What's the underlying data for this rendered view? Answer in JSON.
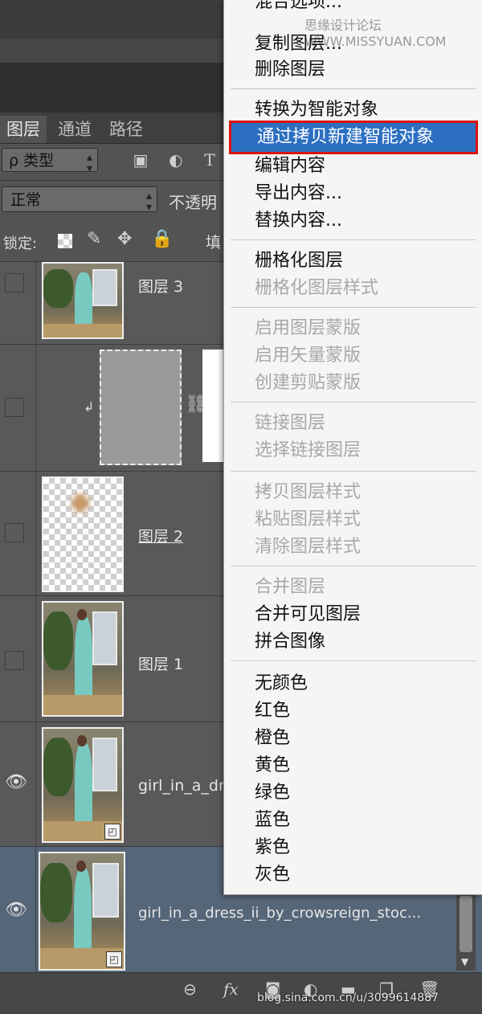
{
  "panel": {
    "tabs": [
      "图层",
      "通道",
      "路径"
    ],
    "filter_kind": "ρ 类型",
    "blend_mode": "正常",
    "opacity_label": "不透明",
    "lock_label": "锁定:",
    "fill_label": "填"
  },
  "layers": [
    {
      "name": "图层 3",
      "visible": false
    },
    {
      "name": "",
      "visible": false,
      "mask": true
    },
    {
      "name": "图层 2",
      "visible": false
    },
    {
      "name": "图层 1",
      "visible": false
    },
    {
      "name": "girl_in_a_dr",
      "visible": true
    },
    {
      "name": "girl_in_a_dress_ii_by_crowsreign_stoc...",
      "visible": true,
      "selected": true
    }
  ],
  "menu": {
    "top_partial": "混合选项...",
    "watermark": "思缘设计论坛 WWW.MISSYUAN.COM",
    "items": [
      {
        "label": "复制图层...",
        "disabled": false
      },
      {
        "label": "删除图层",
        "disabled": false
      },
      {
        "label": "转换为智能对象",
        "disabled": false
      },
      {
        "label": "通过拷贝新建智能对象",
        "disabled": false,
        "highlighted": true
      },
      {
        "label": "编辑内容",
        "disabled": false
      },
      {
        "label": "导出内容...",
        "disabled": false
      },
      {
        "label": "替换内容...",
        "disabled": false
      },
      {
        "label": "栅格化图层",
        "disabled": false
      },
      {
        "label": "栅格化图层样式",
        "disabled": true
      },
      {
        "label": "启用图层蒙版",
        "disabled": true
      },
      {
        "label": "启用矢量蒙版",
        "disabled": true
      },
      {
        "label": "创建剪贴蒙版",
        "disabled": true
      },
      {
        "label": "链接图层",
        "disabled": true
      },
      {
        "label": "选择链接图层",
        "disabled": true
      },
      {
        "label": "拷贝图层样式",
        "disabled": true
      },
      {
        "label": "粘贴图层样式",
        "disabled": true
      },
      {
        "label": "清除图层样式",
        "disabled": true
      },
      {
        "label": "合并图层",
        "disabled": true
      },
      {
        "label": "合并可见图层",
        "disabled": false
      },
      {
        "label": "拼合图像",
        "disabled": false
      },
      {
        "label": "无颜色",
        "disabled": false
      },
      {
        "label": "红色",
        "disabled": false
      },
      {
        "label": "橙色",
        "disabled": false
      },
      {
        "label": "黄色",
        "disabled": false
      },
      {
        "label": "绿色",
        "disabled": false
      },
      {
        "label": "蓝色",
        "disabled": false
      },
      {
        "label": "紫色",
        "disabled": false
      },
      {
        "label": "灰色",
        "disabled": false
      }
    ]
  },
  "bottom": {
    "icons": [
      "link-icon",
      "fx-icon",
      "mask-icon",
      "adjustment-icon",
      "folder-icon",
      "new-layer-icon",
      "trash-icon"
    ],
    "fx_label": "fx",
    "credit": "blog.sina.com.cn/u/3099614887"
  },
  "colors": {
    "panel_bg": "#535353",
    "selected_row": "#566679",
    "menu_highlight": "#2c6fc1",
    "annotation_box": "#dd1111"
  }
}
